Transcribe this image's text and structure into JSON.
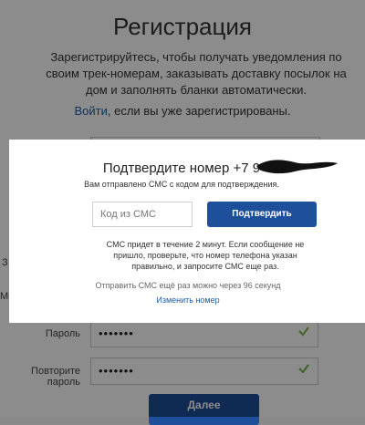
{
  "page": {
    "title": "Регистрация",
    "intro": "Зарегистрируйтесь, чтобы получать уведомления по своим трек-номерам, заказывать доставку посылок на дом и заполнять бланки автоматически.",
    "login_link": "Войти",
    "login_rest": ", если вы уже зарегистрированы.",
    "side_label_a": "З",
    "side_label_b": "Мо",
    "password_label": "Пароль",
    "password_value": "•••••••",
    "repeat_label": "Повторите пароль",
    "repeat_value": "•••••••",
    "submit_label": "Далее"
  },
  "modal": {
    "title": "Подтвердите номер +7 9",
    "subtitle": "Вам отправлено СМС с кодом для подтверждения.",
    "code_placeholder": "Код из СМС",
    "confirm_label": "Подтвердить",
    "note": "СМС придет в течение 2 минут. Если сообщение не пришло, проверьте, что номер телефона указан правильно, и запросите СМС еще раз.",
    "resend": "Отправить СМС ещё раз можно через 96 секунд",
    "change_number": "Изменить номер"
  },
  "colors": {
    "accent": "#1d4f9a",
    "link": "#1f5da8",
    "check": "#7ab648",
    "overlay": "rgba(0,0,0,0.45)"
  }
}
